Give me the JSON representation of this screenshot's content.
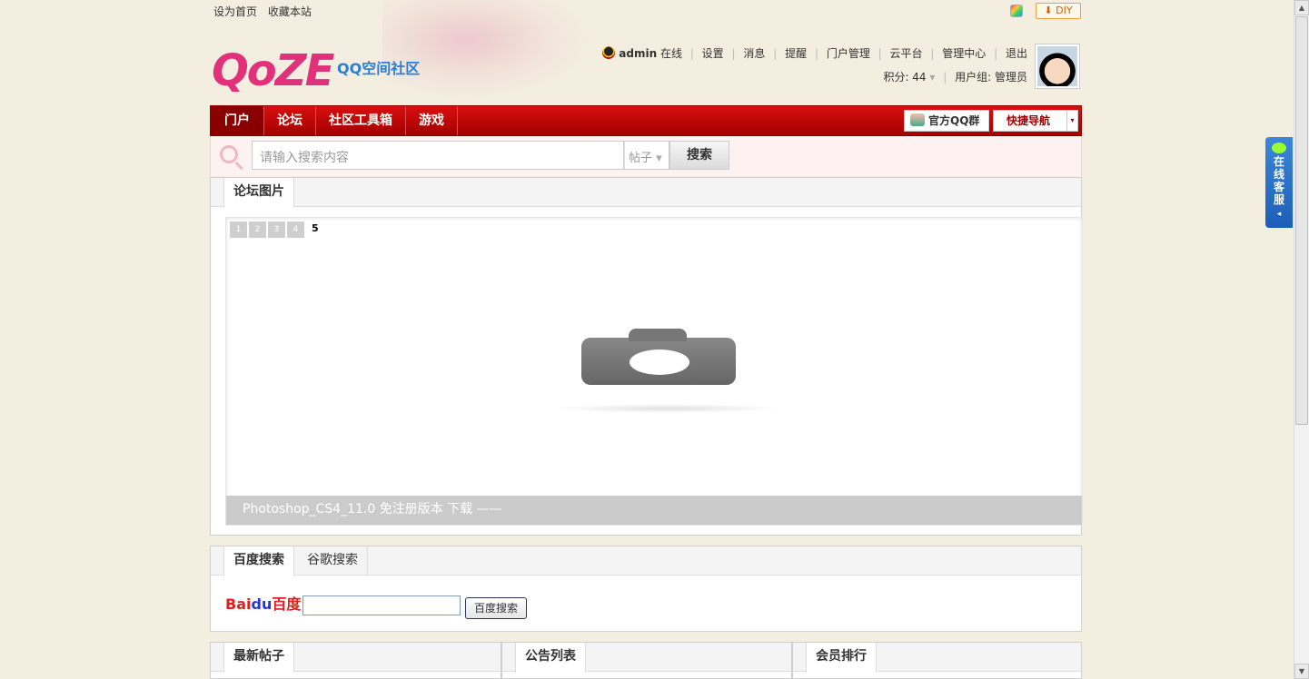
{
  "topbar": {
    "set_home": "设为首页",
    "bookmark": "收藏本站",
    "diy": "DIY",
    "diy_arrow": "⬇"
  },
  "logo": {
    "main": "QoZE",
    "sub": "QQ空间社区"
  },
  "user": {
    "name": "admin",
    "status": "在线",
    "links": [
      "设置",
      "消息",
      "提醒",
      "门户管理",
      "云平台",
      "管理中心",
      "退出"
    ],
    "points_label": "积分: 44",
    "group_label": "用户组: 管理员"
  },
  "nav": {
    "items": [
      "门户",
      "论坛",
      "社区工具箱",
      "游戏"
    ],
    "qq_group": "官方QQ群",
    "quick_nav": "快捷导航",
    "dropdown_glyph": "▾"
  },
  "search": {
    "placeholder": "请输入搜索内容",
    "type": "帖子",
    "type_arrow": "▾",
    "button": "搜索"
  },
  "forum_images": {
    "tab": "论坛图片",
    "pages": [
      "1",
      "2",
      "3",
      "4"
    ],
    "current_page": "5",
    "caption": "Photoshop_CS4_11.0 免注册版本 下载 ——"
  },
  "search_engines": {
    "tabs": [
      "百度搜索",
      "谷歌搜索"
    ],
    "logo_text_red": "Bai",
    "logo_text_blue": "du",
    "logo_text_cn": "百度",
    "button": "百度搜索"
  },
  "bottom_tabs": [
    "最新帖子",
    "公告列表",
    "会员排行"
  ],
  "service": {
    "text": "在线客服",
    "arrow": "◂"
  },
  "scroll": {
    "up": "▲",
    "down": "▼"
  },
  "colors": {
    "nav_red": "#c00000",
    "accent_pink": "#e0317a",
    "service_blue": "#2a6fd0"
  }
}
